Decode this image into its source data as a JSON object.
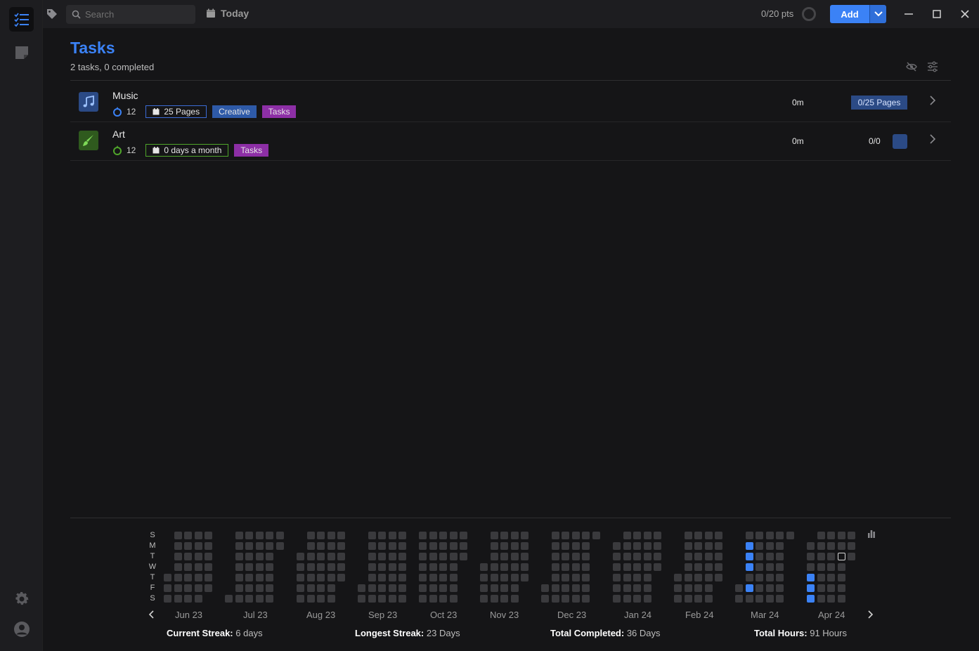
{
  "search": {
    "placeholder": "Search"
  },
  "toolbar": {
    "today_label": "Today",
    "points": "0/20 pts",
    "add_label": "Add"
  },
  "page": {
    "title": "Tasks",
    "subtitle": "2 tasks, 0 completed"
  },
  "tasks": [
    {
      "name": "Music",
      "icon": "music-note-icon",
      "icon_bg": "#2b4a85",
      "streak": "12",
      "streak_color": "#3b82f6",
      "goal": "25 Pages",
      "tags": [
        {
          "label": "Creative",
          "color": "#2e5aa8"
        },
        {
          "label": "Tasks",
          "color": "#8d2fa6"
        }
      ],
      "time": "0m",
      "progress": "0/25 Pages"
    },
    {
      "name": "Art",
      "icon": "brush-icon",
      "icon_bg": "#2f5a1e",
      "streak": "12",
      "streak_color": "#4fa52a",
      "goal": "0 days a month",
      "tags": [
        {
          "label": "Tasks",
          "color": "#8d2fa6"
        }
      ],
      "time": "0m",
      "count": "0/0"
    }
  ],
  "heatmap": {
    "day_labels": [
      "S",
      "M",
      "T",
      "W",
      "T",
      "F",
      "S"
    ],
    "months": [
      "Jun 23",
      "Jul 23",
      "Aug 23",
      "Sep 23",
      "Oct 23",
      "Nov 23",
      "Dec 23",
      "Jan 24",
      "Feb 24",
      "Mar 24",
      "Apr 24"
    ],
    "on_color": "#3b82f6",
    "off_color": "#3a3a3d"
  },
  "stats": {
    "current_streak_label": "Current Streak:",
    "current_streak_value": "6 days",
    "longest_streak_label": "Longest Streak:",
    "longest_streak_value": "23 Days",
    "total_completed_label": "Total Completed:",
    "total_completed_value": "36 Days",
    "total_hours_label": "Total Hours:",
    "total_hours_value": "91 Hours"
  }
}
